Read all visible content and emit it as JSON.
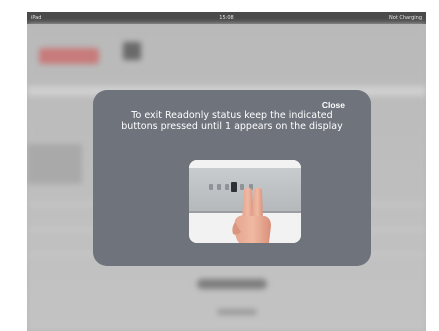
{
  "status_bar": {
    "device": "iPad",
    "time": "15:08",
    "battery": "Not Charging"
  },
  "modal": {
    "close_label": "Close",
    "message": "To exit Readonly status keep the indicated buttons pressed until 1 appears on the display",
    "image_icon": "fingers-pressing-buttons"
  },
  "colors": {
    "modal_bg": "#6e737c",
    "overlay_bg": "#b7b7b7"
  }
}
